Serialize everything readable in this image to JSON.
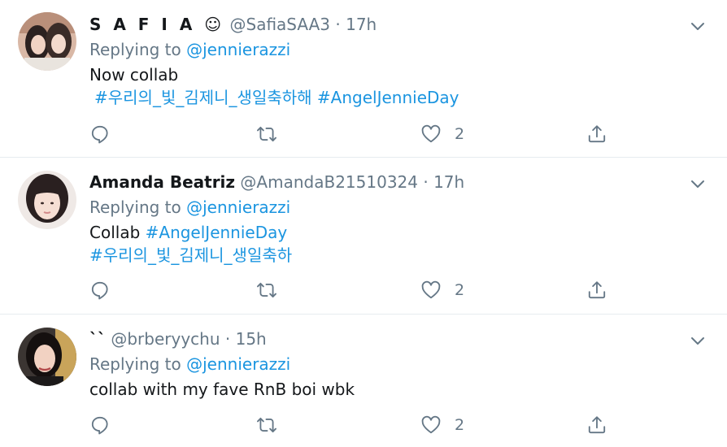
{
  "tweets": [
    {
      "name": "S A F I A ☺",
      "handle": "@SafiaSAA3",
      "time": "17h",
      "replying_label": "Replying to",
      "replying_to": "@jennierazzi",
      "text": "Now collab",
      "hashtags": [
        "#우리의_빛_김제니_생일축하해",
        "#AngelJennieDay"
      ],
      "like_count": "2"
    },
    {
      "name": "Amanda Beatriz",
      "handle": "@AmandaB21510324",
      "time": "17h",
      "replying_label": "Replying to",
      "replying_to": "@jennierazzi",
      "text": "Collab",
      "hashtag1": "#AngelJennieDay",
      "hashtag2": "#우리의_빛_김제니_생일축하",
      "like_count": "2"
    },
    {
      "name": "``",
      "handle": "@brberyychu",
      "time": "15h",
      "replying_label": "Replying to",
      "replying_to": "@jennierazzi",
      "text": "collab with my fave RnB boi wbk",
      "like_count": "2"
    }
  ],
  "separator": "·",
  "icons": [
    "chevron-down-icon",
    "reply-icon",
    "retweet-icon",
    "like-icon",
    "share-icon"
  ],
  "colors": {
    "link": "#1b95e0",
    "secondary": "#657786",
    "divider": "#e6ecf0",
    "text": "#14171a"
  }
}
